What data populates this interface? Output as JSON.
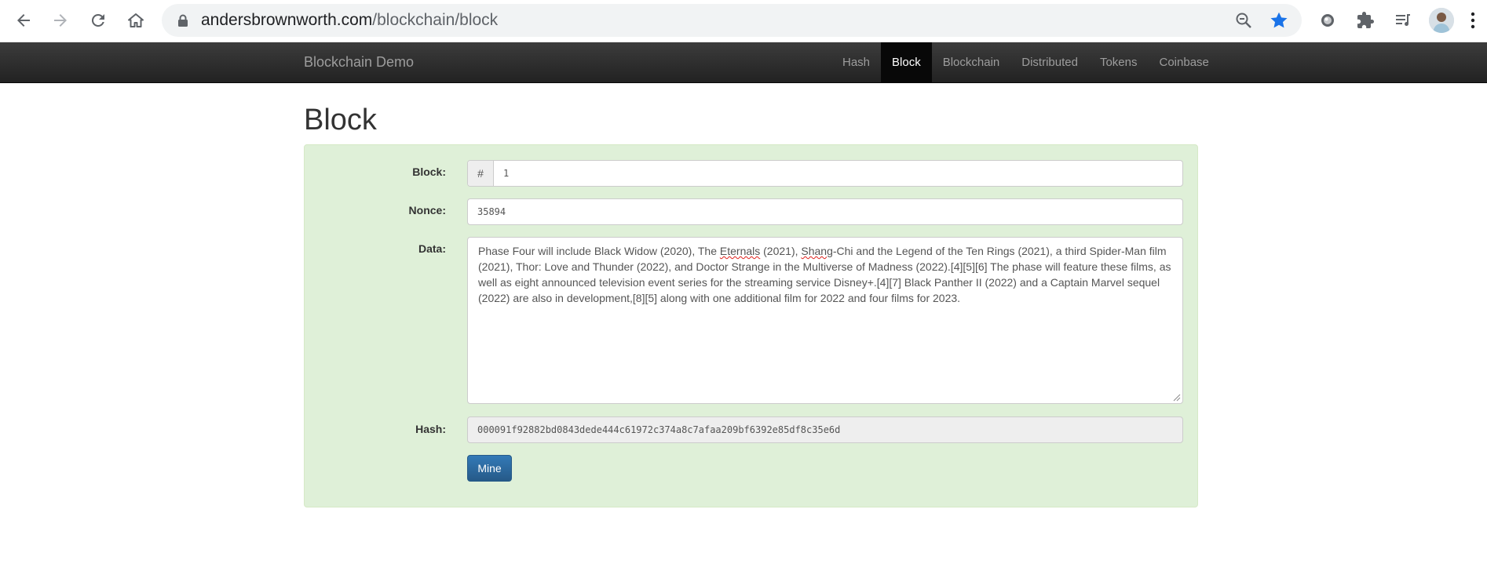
{
  "browser": {
    "url_host": "andersbrownworth.com",
    "url_path": "/blockchain/block",
    "icons": [
      "back-icon",
      "forward-icon",
      "reload-icon",
      "home-icon",
      "lock-icon",
      "zoom-out-icon",
      "bookmark-star-icon",
      "extension-icon",
      "puzzle-icon",
      "media-control-icon",
      "avatar",
      "kebab-menu-icon"
    ],
    "star_color": "#1a73e8"
  },
  "navbar": {
    "brand": "Blockchain Demo",
    "items": [
      {
        "label": "Hash",
        "active": false
      },
      {
        "label": "Block",
        "active": true
      },
      {
        "label": "Blockchain",
        "active": false
      },
      {
        "label": "Distributed",
        "active": false
      },
      {
        "label": "Tokens",
        "active": false
      },
      {
        "label": "Coinbase",
        "active": false
      }
    ]
  },
  "page": {
    "title": "Block",
    "well_color": "#dff0d8",
    "block": {
      "label": "Block:",
      "prefix": "#",
      "value": "1"
    },
    "nonce": {
      "label": "Nonce:",
      "value": "35894"
    },
    "data": {
      "label": "Data:",
      "p1": "Phase Four will include Black Widow (2020), The ",
      "w1": "Eternals",
      "p2": " (2021), ",
      "w2": "Shang",
      "p3": "-Chi and the Legend of the Ten Rings (2021), a third Spider-Man film (2021), Thor: Love and Thunder (2022), and Doctor Strange in the Multiverse of Madness (2022).[4][5][6] The phase will feature these films, as well as eight announced television event series for the streaming service Disney+.[4][7] Black Panther II (2022) and a Captain Marvel sequel (2022) are also in development,[8][5] along with one additional film for 2022 and four films for 2023."
    },
    "hash": {
      "label": "Hash:",
      "value": "000091f92882bd0843dede444c61972c374a8c7afaa209bf6392e85df8c35e6d"
    },
    "mine_button": "Mine"
  }
}
